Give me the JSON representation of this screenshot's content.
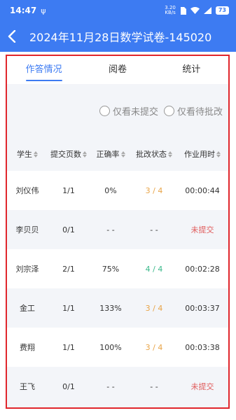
{
  "status_bar": {
    "time": "14:47",
    "misc": "ψ",
    "speed_top": "3.20",
    "speed_bottom": "KB/s",
    "battery": "73"
  },
  "header": {
    "title": "2024年11月28日数学试卷-145020"
  },
  "tabs": [
    {
      "label": "作答情况",
      "active": true
    },
    {
      "label": "阅卷",
      "active": false
    },
    {
      "label": "统计",
      "active": false
    }
  ],
  "filters": {
    "unsubmitted_label": "仅看未提交",
    "pending_label": "仅看待批改"
  },
  "table": {
    "headers": [
      "学生",
      "提交页数",
      "正确率",
      "批改状态",
      "作业用时"
    ],
    "rows": [
      {
        "student": "刘仪伟",
        "pages": "1/1",
        "accuracy": "0%",
        "status": "3 / 4",
        "time": "00:00:44",
        "status_color": "orange"
      },
      {
        "student": "李贝贝",
        "pages": "0/1",
        "accuracy": "- -",
        "status": "- -",
        "time": "未提交",
        "status_color": "none"
      },
      {
        "student": "刘宗泽",
        "pages": "2/1",
        "accuracy": "75%",
        "status": "4 / 4",
        "time": "00:02:28",
        "status_color": "green"
      },
      {
        "student": "金工",
        "pages": "1/1",
        "accuracy": "133%",
        "status": "3 / 4",
        "time": "00:03:37",
        "status_color": "orange"
      },
      {
        "student": "费翔",
        "pages": "1/1",
        "accuracy": "100%",
        "status": "3 / 4",
        "time": "00:03:38",
        "status_color": "orange"
      },
      {
        "student": "王飞",
        "pages": "0/1",
        "accuracy": "- -",
        "status": "- -",
        "time": "未提交",
        "status_color": "none"
      }
    ]
  },
  "colors": {
    "primary": "#3d7bf2",
    "orange": "#e8a447",
    "green": "#3bb98b",
    "red": "#e05b5b",
    "highlight_border": "#e0262c"
  }
}
